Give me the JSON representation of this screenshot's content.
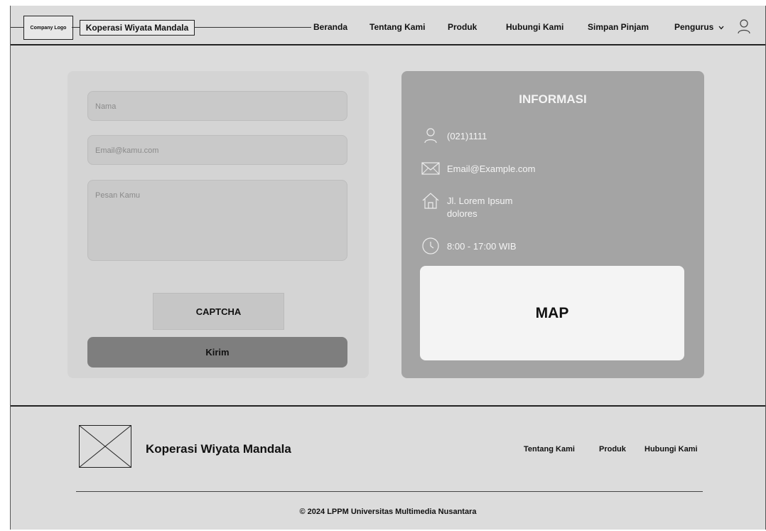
{
  "header": {
    "logo_text": "Company Logo",
    "brand": "Koperasi Wiyata Mandala",
    "nav": [
      "Beranda",
      "Tentang Kami",
      "Produk",
      "Hubungi Kami",
      "Simpan Pinjam",
      "Pengurus"
    ],
    "dropdown_glyph": "⌄",
    "user_icon": "user-icon"
  },
  "form": {
    "name_placeholder": "Nama",
    "email_placeholder": "Email@kamu.com",
    "message_placeholder": "Pesan Kamu",
    "captcha_label": "CAPTCHA",
    "submit_label": "Kirim"
  },
  "info": {
    "title": "INFORMASI",
    "phone": "(021)1111",
    "email": "Email@Example.com",
    "address_line1": "Jl. Lorem Ipsum",
    "address_line2": "dolores",
    "hours": "8:00 - 17:00 WIB",
    "map_label": "MAP",
    "icons": [
      "user-icon",
      "mail-icon",
      "home-icon",
      "clock-icon"
    ]
  },
  "footer": {
    "brand": "Koperasi Wiyata Mandala",
    "links": [
      "Tentang Kami",
      "Produk",
      "Hubungi Kami"
    ],
    "copyright": "© 2024 LPPM Universitas Multimedia Nusantara"
  },
  "colors": {
    "background": "#dcdcdc",
    "form_card": "#d4d4d4",
    "info_card": "#a4a4a4",
    "submit_button": "#7e7e7e",
    "map": "#f4f4f4"
  }
}
